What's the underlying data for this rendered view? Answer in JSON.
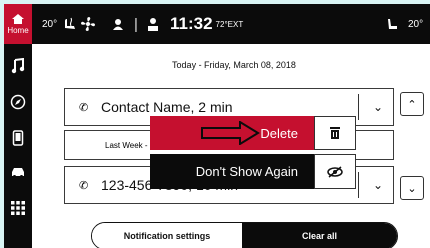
{
  "sidebar": {
    "home_label": "Home",
    "items": [
      {
        "icon": "music-note-icon"
      },
      {
        "icon": "compass-icon"
      },
      {
        "icon": "phone-icon"
      },
      {
        "icon": "car-icon"
      },
      {
        "icon": "apps-grid-icon"
      }
    ]
  },
  "status": {
    "left_temp": "20°",
    "time": "11:32",
    "ext_temp": "72°EXT",
    "right_temp": "20°",
    "icons": [
      "seat-heat-icon",
      "fan-icon",
      "profile-icon",
      "user-icon",
      "seat-icon"
    ]
  },
  "notifications": {
    "date_header": "Today - Friday, March 08, 2018",
    "card1_text": "Contact Name, 2 min",
    "card2_sub": "Last Week - Friday, March 01, 2018",
    "card3_text": "123-456-7890, 10 min"
  },
  "menu": {
    "delete_label": "Delete",
    "hide_label": "Don't Show Again"
  },
  "footer": {
    "settings_label": "Notification settings",
    "clear_label": "Clear all"
  },
  "colors": {
    "accent": "#c5102f",
    "dark": "#0b0b0b"
  }
}
